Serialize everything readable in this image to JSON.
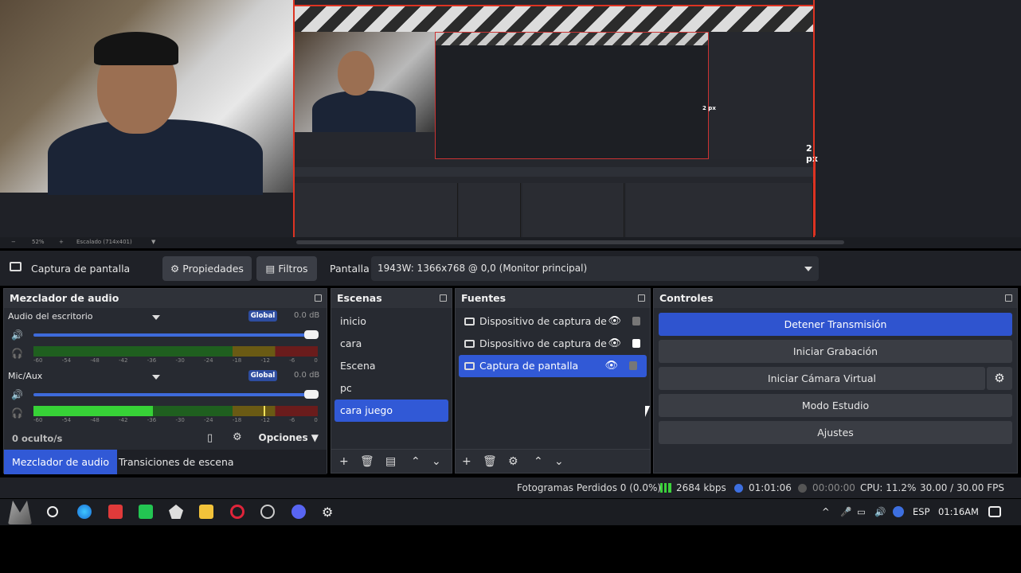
{
  "preview": {
    "dimension_label_1": "2 px",
    "dimension_label_2": "2 px",
    "zoom": "52%",
    "scale": "Escalado (714x401)"
  },
  "context": {
    "source_label": "Captura de pantalla",
    "properties_label": "Propiedades",
    "filters_label": "Filtros",
    "screen_label": "Pantalla",
    "screen_value": "1943W: 1366x768 @ 0,0 (Monitor principal)"
  },
  "mixer": {
    "title": "Mezclador de audio",
    "channels": [
      {
        "name": "Audio del escritorio",
        "global": "Global",
        "db": "0.0 dB",
        "level": 0.0,
        "peak": 0.0
      },
      {
        "name": "Mic/Aux",
        "global": "Global",
        "db": "0.0 dB",
        "level": 0.42,
        "peak": 0.81
      }
    ],
    "ticks": [
      "-60",
      "-54",
      "-48",
      "-42",
      "-36",
      "-30",
      "-24",
      "-18",
      "-12",
      "-6",
      "0"
    ],
    "hidden": "0 oculto/s",
    "options": "Opciones",
    "tabs": [
      "Mezclador de audio",
      "Transiciones de escena"
    ]
  },
  "scenes": {
    "title": "Escenas",
    "items": [
      "inicio",
      "cara",
      "Escena",
      "pc",
      "cara juego"
    ]
  },
  "sources": {
    "title": "Fuentes",
    "items": [
      {
        "name": "Dispositivo de captura de vic",
        "locked": false
      },
      {
        "name": "Dispositivo de captura de vic",
        "locked": true
      },
      {
        "name": "Captura de pantalla",
        "locked": false
      }
    ]
  },
  "controls": {
    "title": "Controles",
    "stop_stream": "Detener Transmisión",
    "start_record": "Iniciar Grabación",
    "start_virtual_cam": "Iniciar Cámara Virtual",
    "studio_mode": "Modo Estudio",
    "settings": "Ajustes"
  },
  "status": {
    "dropped_frames": "Fotogramas Perdidos 0 (0.0%)",
    "bitrate": "2684 kbps",
    "stream_time": "01:01:06",
    "record_time": "00:00:00",
    "cpu": "CPU: 11.2%",
    "fps": "30.00 / 30.00 FPS"
  },
  "taskbar": {
    "language": "ESP",
    "clock": "01:16AM"
  },
  "colors": {
    "accent": "#3159d6",
    "panel": "#272a31",
    "live_green": "#37d237"
  }
}
